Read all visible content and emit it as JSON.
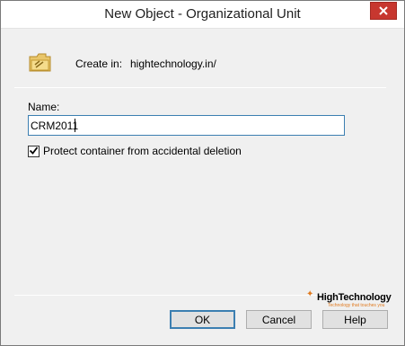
{
  "window": {
    "title": "New Object - Organizational Unit",
    "close_icon": "close-icon"
  },
  "header": {
    "icon": "folder-ou-icon",
    "create_in_label": "Create in:",
    "create_in_value": "hightechnology.in/"
  },
  "form": {
    "name_label": "Name:",
    "name_value": "CRM2011",
    "protect_checked": true,
    "protect_label": "Protect container from accidental deletion"
  },
  "watermark": {
    "brand": "HighTechnology",
    "tagline": "Technology that touches you"
  },
  "buttons": {
    "ok": "OK",
    "cancel": "Cancel",
    "help": "Help"
  },
  "colors": {
    "close_red": "#c7372f",
    "focus_blue": "#3c7fb1",
    "accent_orange": "#e07a1f"
  }
}
